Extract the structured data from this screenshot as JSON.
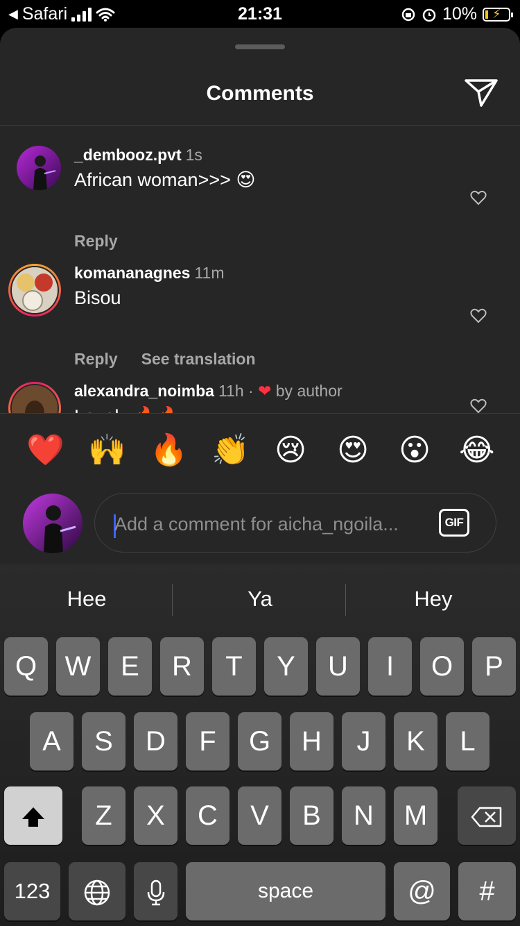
{
  "status_bar": {
    "back_app": "Safari",
    "time": "21:31",
    "battery": "10%"
  },
  "sheet": {
    "title": "Comments"
  },
  "comments": [
    {
      "username": "_dembooz.pvt",
      "time": "1s",
      "text": "African woman>>> 😍",
      "reply": "Reply"
    },
    {
      "username": "komananagnes",
      "time": "11m",
      "text": "Bisou",
      "reply": "Reply",
      "translate": "See translation"
    },
    {
      "username": "alexandra_noimba",
      "time": "11h",
      "liked_by": "by author",
      "text": "Lovely 🔥🔥"
    }
  ],
  "emoji_bar": [
    "❤️",
    "🙌",
    "🔥",
    "👏",
    "😢",
    "😍",
    "😮",
    "😂"
  ],
  "composer": {
    "placeholder": "Add a comment for aicha_ngoila...",
    "gif_label": "GIF"
  },
  "keyboard": {
    "suggestions": [
      "Hee",
      "Ya",
      "Hey"
    ],
    "row1": [
      "Q",
      "W",
      "E",
      "R",
      "T",
      "Y",
      "U",
      "I",
      "O",
      "P"
    ],
    "row2": [
      "A",
      "S",
      "D",
      "F",
      "G",
      "H",
      "J",
      "K",
      "L"
    ],
    "row3": [
      "Z",
      "X",
      "C",
      "V",
      "B",
      "N",
      "M"
    ],
    "numbers_label": "123",
    "space_label": "space",
    "at_label": "@",
    "hash_label": "#"
  },
  "colors": {
    "sheet_bg": "#262626",
    "heart_red": "#ff3040",
    "cursor_blue": "#3f63ff",
    "avatar_purple": "#8a1fb0"
  }
}
